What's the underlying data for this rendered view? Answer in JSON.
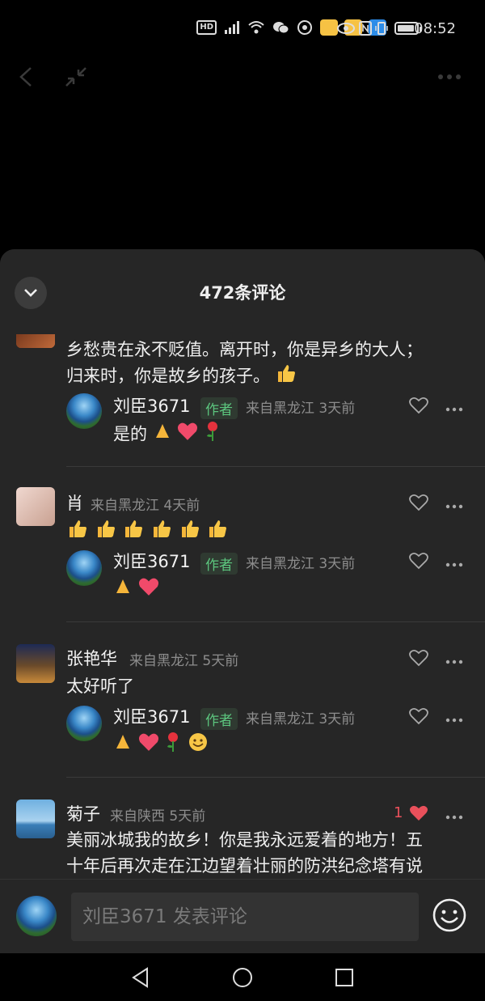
{
  "status_bar": {
    "hd": "HD",
    "time": "08:52"
  },
  "panel": {
    "title": "472条评论"
  },
  "comments": [
    {
      "text_line1": "乡愁贵在永不贬值。离开时，你是异乡的大人；",
      "text_line2": "归来时，你是故乡的孩子。",
      "reply": {
        "name": "刘臣3671",
        "tag": "作者",
        "meta": "来自黑龙江  3天前",
        "text": "是的"
      }
    },
    {
      "name": "肖",
      "meta": "来自黑龙江  4天前",
      "reply": {
        "name": "刘臣3671",
        "tag": "作者",
        "meta": "来自黑龙江  3天前"
      }
    },
    {
      "name": "张艳华",
      "meta": "来自黑龙江  5天前",
      "text": "太好听了",
      "reply": {
        "name": "刘臣3671",
        "tag": "作者",
        "meta": "来自黑龙江  3天前"
      }
    },
    {
      "name": "菊子",
      "meta": "来自陕西  5天前",
      "likes": "1",
      "text_line1": "美丽冰城我的故乡！你是我永远爱着的地方！五",
      "text_line2": "十年后再次走在江边望着壮丽的防洪纪念塔有说"
    }
  ],
  "input": {
    "placeholder": "刘臣3671 发表评论"
  },
  "colors": {
    "panel_bg": "#262626",
    "author_tag": "#5cc67e",
    "like_red": "#e9505b"
  },
  "icons": [
    "back-icon",
    "shrink-icon",
    "more-icon",
    "chevron-down-icon",
    "heart-icon",
    "more-dots-icon",
    "emoji-icon",
    "nav-back-icon",
    "nav-home-icon",
    "nav-recent-icon"
  ]
}
